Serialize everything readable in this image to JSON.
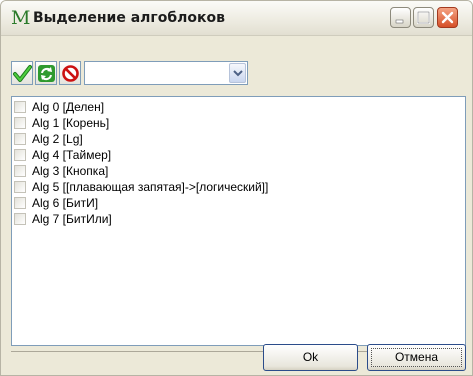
{
  "window": {
    "title": "Выделение алгоблоков",
    "app_icon_glyph": "M"
  },
  "toolbar": {
    "check_icon": "check-all-icon",
    "refresh_icon": "refresh-icon",
    "stop_icon": "stop-icon",
    "combo_value": ""
  },
  "list": {
    "items": [
      {
        "label": "Alg 0  [Делен]",
        "checked": false
      },
      {
        "label": "Alg 1  [Корень]",
        "checked": false
      },
      {
        "label": "Alg 2  [Lg]",
        "checked": false
      },
      {
        "label": "Alg 4  [Таймер]",
        "checked": false
      },
      {
        "label": "Alg 3  [Кнопка]",
        "checked": false
      },
      {
        "label": "Alg 5  [[плавающая запятая]->[логический]]",
        "checked": false
      },
      {
        "label": "Alg 6  [БитИ]",
        "checked": false
      },
      {
        "label": "Alg 7  [БитИли]",
        "checked": false
      }
    ]
  },
  "buttons": {
    "ok": "Ok",
    "cancel": "Отмена"
  },
  "colors": {
    "accent_green": "#2aa02a",
    "close_red": "#d65028",
    "stop_red": "#cc1111"
  }
}
